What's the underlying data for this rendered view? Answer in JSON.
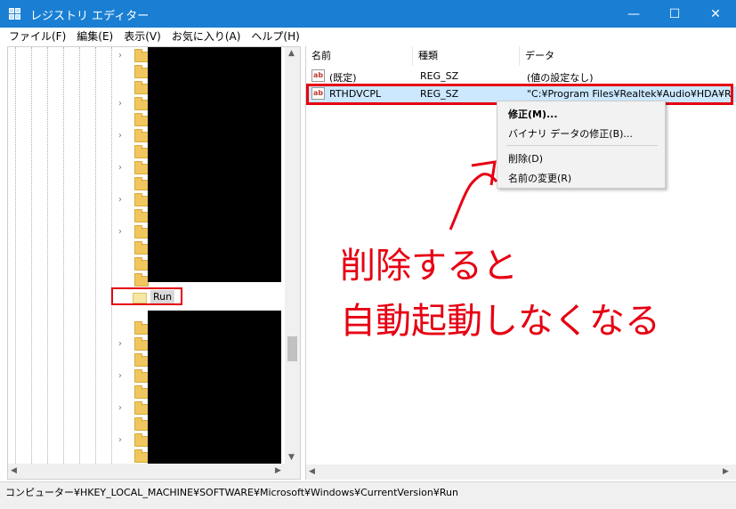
{
  "window": {
    "title": "レジストリ エディター",
    "minimize_glyph": "—",
    "maximize_glyph": "☐",
    "close_glyph": "✕"
  },
  "menu": [
    "ファイル(F)",
    "編集(E)",
    "表示(V)",
    "お気に入り(A)",
    "ヘルプ(H)"
  ],
  "tree": {
    "selected_key": "Run",
    "scroll_up": "▲",
    "scroll_down": "▼",
    "scroll_left": "◀",
    "scroll_right": "▶"
  },
  "list": {
    "headers": [
      "名前",
      "種類",
      "データ"
    ],
    "rows": [
      {
        "icon": "ab",
        "name": "(既定)",
        "type": "REG_SZ",
        "data": "(値の設定なし)"
      },
      {
        "icon": "ab",
        "name": "RTHDVCPL",
        "type": "REG_SZ",
        "data": "\"C:¥Program Files¥Realtek¥Audio¥HDA¥Rtk"
      }
    ]
  },
  "context_menu": {
    "items": [
      "修正(M)...",
      "バイナリ データの修正(B)...",
      "削除(D)",
      "名前の変更(R)"
    ]
  },
  "annotation": {
    "line1": "削除すると",
    "line2": "自動起動しなくなる",
    "color": "#e60012"
  },
  "statusbar": {
    "path": "コンピューター¥HKEY_LOCAL_MACHINE¥SOFTWARE¥Microsoft¥Windows¥CurrentVersion¥Run"
  },
  "colors": {
    "titlebar": "#1a7fd3",
    "selection": "#cce8ff",
    "highlight_red": "#e60012"
  }
}
